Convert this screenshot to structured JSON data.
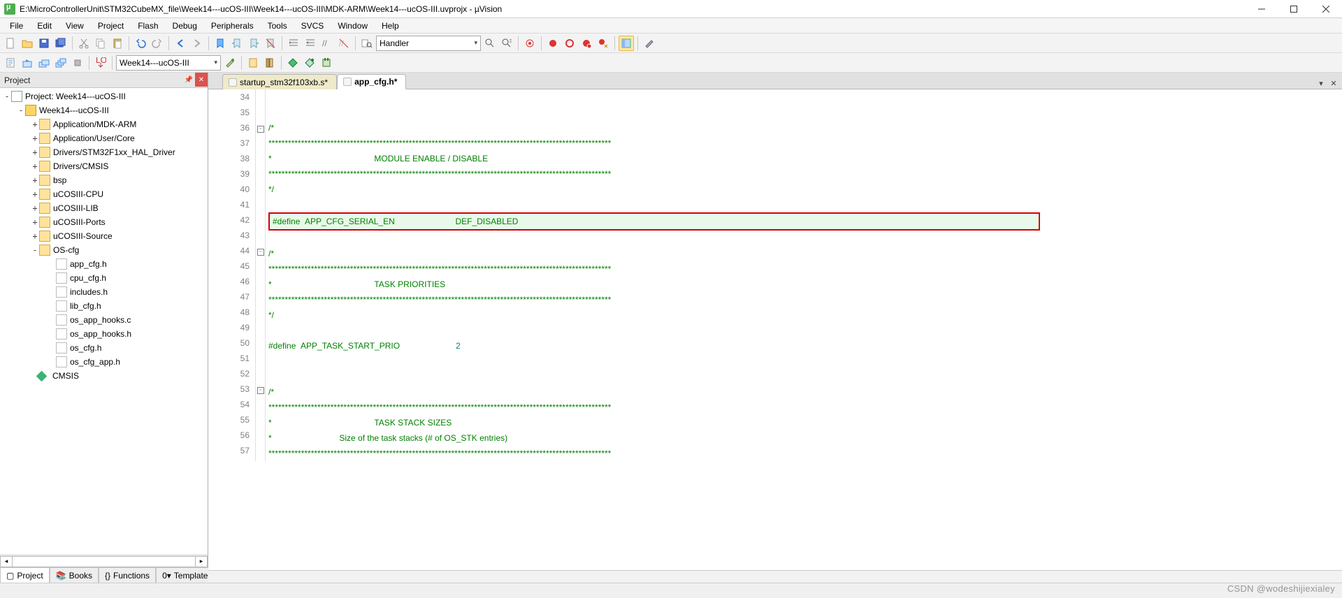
{
  "window": {
    "title": "E:\\MicroControllerUnit\\STM32CubeMX_file\\Week14---ucOS-III\\Week14---ucOS-III\\MDK-ARM\\Week14---ucOS-III.uvprojx - µVision"
  },
  "menu": [
    "File",
    "Edit",
    "View",
    "Project",
    "Flash",
    "Debug",
    "Peripherals",
    "Tools",
    "SVCS",
    "Window",
    "Help"
  ],
  "toolbar1": {
    "find_combo": "Handler"
  },
  "toolbar2": {
    "target_combo": "Week14---ucOS-III"
  },
  "project_panel": {
    "title": "Project",
    "root": "Project: Week14---ucOS-III",
    "target": "Week14---ucOS-III",
    "groups": [
      "Application/MDK-ARM",
      "Application/User/Core",
      "Drivers/STM32F1xx_HAL_Driver",
      "Drivers/CMSIS",
      "bsp",
      "uCOSIII-CPU",
      "uCOSIII-LIB",
      "uCOSIII-Ports",
      "uCOSIII-Source"
    ],
    "open_group": "OS-cfg",
    "files": [
      "app_cfg.h",
      "cpu_cfg.h",
      "includes.h",
      "lib_cfg.h",
      "os_app_hooks.c",
      "os_app_hooks.h",
      "os_cfg.h",
      "os_cfg_app.h"
    ],
    "last_group": "CMSIS",
    "bottom_tabs": [
      "Project",
      "Books",
      "Functions",
      "Templates"
    ]
  },
  "editor": {
    "tabs": [
      {
        "label": "startup_stm32f103xb.s*",
        "active": false
      },
      {
        "label": "app_cfg.h*",
        "active": true
      }
    ],
    "first_line_no": 34,
    "lines": [
      "",
      "",
      "/*",
      "*********************************************************************************************************",
      "*                                            MODULE ENABLE / DISABLE",
      "*********************************************************************************************************",
      "*/",
      "",
      "#define  APP_CFG_SERIAL_EN                          DEF_DISABLED",
      "",
      "/*",
      "*********************************************************************************************************",
      "*                                            TASK PRIORITIES",
      "*********************************************************************************************************",
      "*/",
      "",
      "#define  APP_TASK_START_PRIO                        2",
      "",
      "",
      "/*",
      "*********************************************************************************************************",
      "*                                            TASK STACK SIZES",
      "*                             Size of the task stacks (# of OS_STK entries)",
      "*********************************************************************************************************"
    ]
  },
  "watermark": "CSDN @wodeshijiexialey"
}
